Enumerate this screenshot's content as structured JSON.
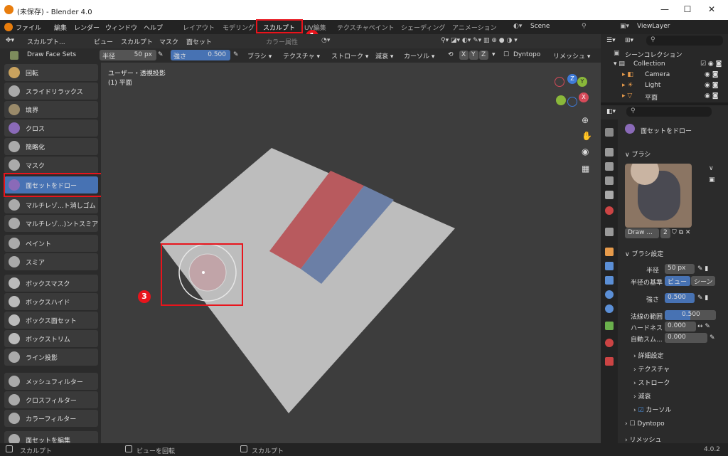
{
  "window": {
    "title": "(未保存) - Blender 4.0"
  },
  "menu": {
    "file": "ファイル",
    "edit": "編集",
    "render": "レンダー",
    "window": "ウィンドウ",
    "help": "ヘルプ"
  },
  "workspaces": [
    "レイアウト",
    "モデリング",
    "スカルプト",
    "UV編集",
    "テクスチャペイント",
    "シェーディング",
    "アニメーション"
  ],
  "scene": {
    "name": "Scene",
    "view_layer": "ViewLayer"
  },
  "header": {
    "mode": "スカルプト...",
    "view": "ビュー",
    "sculpt": "スカルプト",
    "mask": "マスク",
    "face_sets": "面セット",
    "color_attr": "カラー属性",
    "brush_name": "Draw Face Sets",
    "radius_label": "半径",
    "radius_value": "50 px",
    "strength_label": "強さ",
    "strength_value": "0.500",
    "brush": "ブラシ",
    "texture": "テクスチャ",
    "stroke": "ストローク",
    "falloff": "減衰",
    "cursor": "カーソル",
    "x": "X",
    "y": "Y",
    "z": "Z",
    "dyntopo": "Dyntopo",
    "remesh": "リメッシュ"
  },
  "tools": [
    "回転",
    "スライドリラックス",
    "境界",
    "クロス",
    "簡略化",
    "マスク",
    "面セットをドロー",
    "マルチレゾ...ト消しゴム",
    "マルチレゾ...)ントスミア",
    "ペイント",
    "スミア",
    "ボックスマスク",
    "ボックスハイド",
    "ボックス面セット",
    "ボックストリム",
    "ライン投影",
    "メッシュフィルター",
    "クロスフィルター",
    "カラーフィルター",
    "面セットを編集"
  ],
  "viewport": {
    "title": "ユーザー・透視投影",
    "subtitle": "(1) 平面"
  },
  "gizmo": {
    "x": "X",
    "y": "Y",
    "z": "Z"
  },
  "outliner": {
    "title": "シーンコレクション",
    "items": [
      "Collection",
      "Camera",
      "Light",
      "平面"
    ]
  },
  "properties": {
    "brush_mode": "面セットをドロー",
    "brush_panel": "ブラシ",
    "brush_slot_name": "Draw ...",
    "brush_slot_users": "2",
    "settings_panel": "ブラシ設定",
    "radius_label": "半径",
    "radius_value": "50 px",
    "radius_unit_label": "半径の基準",
    "radius_unit_view": "ビュー",
    "radius_unit_scene": "シーン",
    "strength_label": "強さ",
    "strength_value": "0.500",
    "normal_radius_label": "法線の範囲",
    "normal_radius_value": "0.500",
    "hardness_label": "ハードネス",
    "hardness_value": "0.000",
    "autosmooth_label": "自動スム...",
    "autosmooth_value": "0.000",
    "sub_advanced": "詳細設定",
    "sub_texture": "テクスチャ",
    "sub_stroke": "ストローク",
    "sub_falloff": "減衰",
    "sub_cursor": "カーソル",
    "dyntopo": "Dyntopo",
    "remesh": "リメッシュ"
  },
  "status": {
    "left": "スカルプト",
    "middle": "ビューを回転",
    "right": "スカルプト",
    "version": "4.0.2"
  },
  "annotations": [
    "1",
    "2",
    "3"
  ],
  "colors": {
    "accent": "#4772b3",
    "annotation": "#e8141c",
    "face_set_red": "#b85a5e",
    "face_set_blue": "#6b7fa6"
  }
}
